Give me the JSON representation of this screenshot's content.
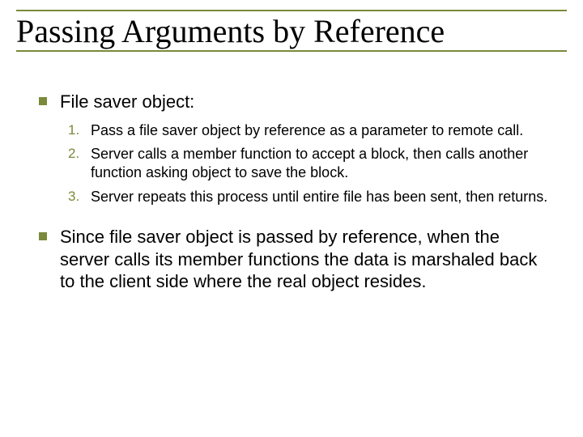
{
  "title": "Passing Arguments by Reference",
  "bullet1": "File saver object:",
  "list": {
    "n1": "1.",
    "t1": "Pass a file saver object by reference as a parameter to remote call.",
    "n2": "2.",
    "t2": "Server calls a member function to accept a block, then calls another function asking object to save the block.",
    "n3": "3.",
    "t3": "Server repeats this process until entire file has been sent, then returns."
  },
  "bullet2": "Since file saver object is passed by reference, when the server calls its member functions the data is marshaled back to the client side where the real object resides."
}
